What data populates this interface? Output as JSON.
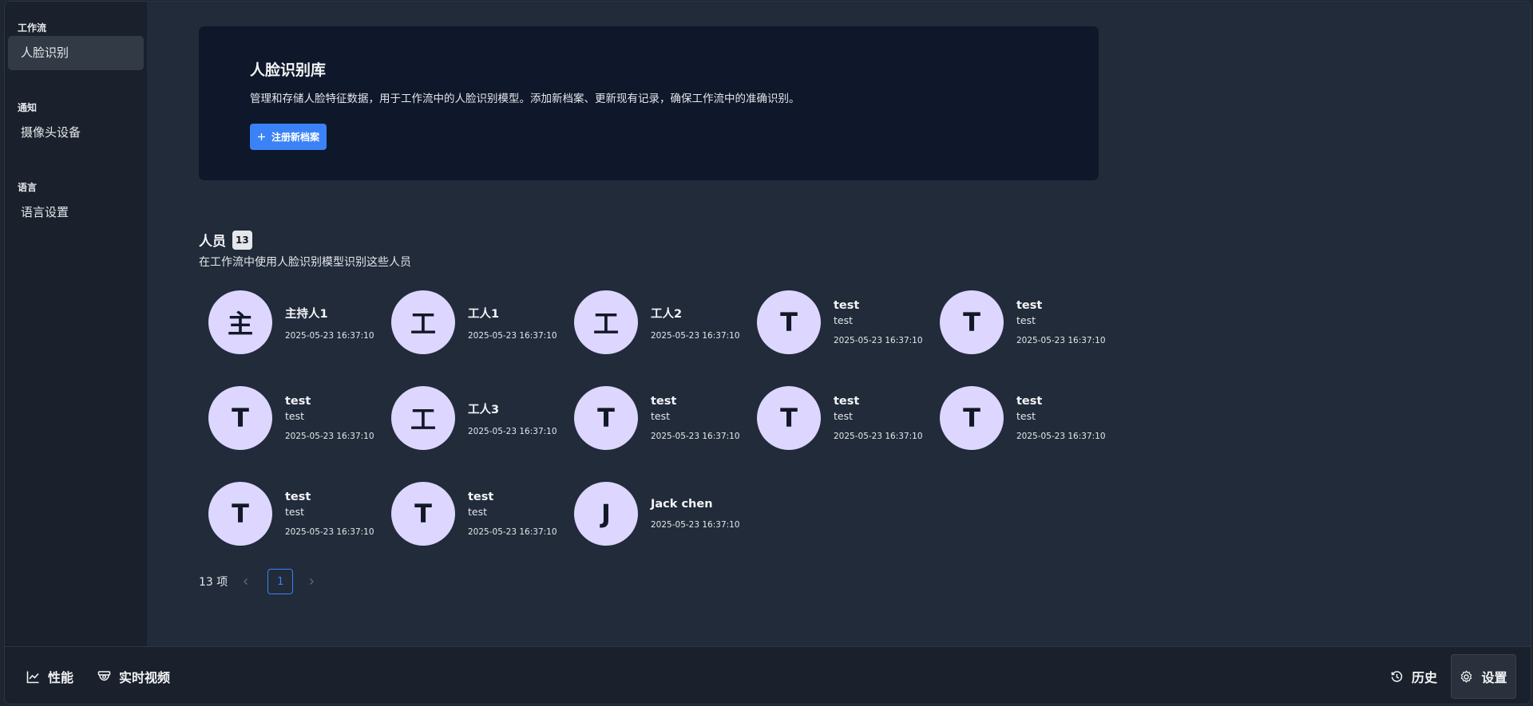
{
  "sidebar": {
    "groups": [
      {
        "title": "工作流",
        "items": [
          {
            "label": "人脸识别",
            "active": true
          }
        ]
      },
      {
        "title": "通知",
        "items": [
          {
            "label": "摄像头设备",
            "active": false
          }
        ]
      },
      {
        "title": "语言",
        "items": [
          {
            "label": "语言设置",
            "active": false
          }
        ]
      }
    ]
  },
  "hero": {
    "title": "人脸识别库",
    "description": "管理和存储人脸特征数据，用于工作流中的人脸识别模型。添加新档案、更新现有记录，确保工作流中的准确识别。",
    "register_button": "注册新档案",
    "accent_color": "#3b82f6"
  },
  "people": {
    "title": "人员",
    "count": "13",
    "subtitle": "在工作流中使用人脸识别模型识别这些人员",
    "items": [
      {
        "initial": "主",
        "name": "主持人1",
        "sub": "",
        "time": "2025-05-23 16:37:10"
      },
      {
        "initial": "工",
        "name": "工人1",
        "sub": "",
        "time": "2025-05-23 16:37:10"
      },
      {
        "initial": "工",
        "name": "工人2",
        "sub": "",
        "time": "2025-05-23 16:37:10"
      },
      {
        "initial": "T",
        "name": "test",
        "sub": "test",
        "time": "2025-05-23 16:37:10"
      },
      {
        "initial": "T",
        "name": "test",
        "sub": "test",
        "time": "2025-05-23 16:37:10"
      },
      {
        "initial": "T",
        "name": "test",
        "sub": "test",
        "time": "2025-05-23 16:37:10"
      },
      {
        "initial": "工",
        "name": "工人3",
        "sub": "",
        "time": "2025-05-23 16:37:10"
      },
      {
        "initial": "T",
        "name": "test",
        "sub": "test",
        "time": "2025-05-23 16:37:10"
      },
      {
        "initial": "T",
        "name": "test",
        "sub": "test",
        "time": "2025-05-23 16:37:10"
      },
      {
        "initial": "T",
        "name": "test",
        "sub": "test",
        "time": "2025-05-23 16:37:10"
      },
      {
        "initial": "T",
        "name": "test",
        "sub": "test",
        "time": "2025-05-23 16:37:10"
      },
      {
        "initial": "T",
        "name": "test",
        "sub": "test",
        "time": "2025-05-23 16:37:10"
      },
      {
        "initial": "J",
        "name": "Jack chen",
        "sub": "",
        "time": "2025-05-23 16:37:10"
      }
    ],
    "avatar_color": "#ddd6fe"
  },
  "pagination": {
    "total_label": "13 项",
    "prev_icon": "chevron-left-icon",
    "current_page": "1",
    "next_icon": "chevron-right-icon"
  },
  "bottombar": {
    "performance_label": "性能",
    "performance_icon": "line-chart-icon",
    "live_video_label": "实时视频",
    "live_video_icon": "camera-icon",
    "history_label": "历史",
    "history_icon": "history-icon",
    "settings_label": "设置",
    "settings_icon": "gear-icon"
  }
}
